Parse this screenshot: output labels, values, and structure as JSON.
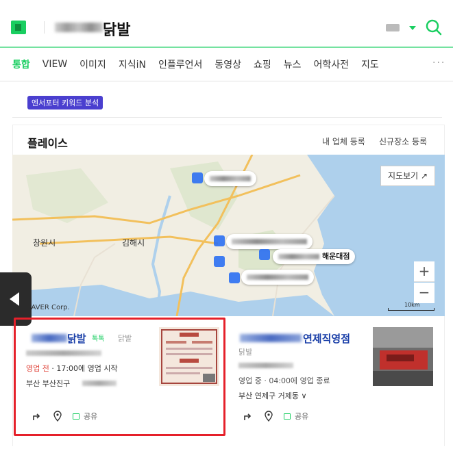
{
  "header": {
    "query_suffix": "닭발",
    "search_icon": "search-icon",
    "accent_color": "#19ce60"
  },
  "tabs": [
    {
      "label": "통합"
    },
    {
      "label": "VIEW"
    },
    {
      "label": "이미지"
    },
    {
      "label": "지식iN"
    },
    {
      "label": "인플루언서"
    },
    {
      "label": "동영상"
    },
    {
      "label": "쇼핑"
    },
    {
      "label": "뉴스"
    },
    {
      "label": "어학사전"
    },
    {
      "label": "지도"
    }
  ],
  "tabs_more": "···",
  "keyword_chip": "엔서포터 키워드 분석",
  "place": {
    "title": "플레이스",
    "link_register": "내 업체 등록",
    "link_new_place": "신규장소 등록",
    "map_view_button": "지도보기 ↗",
    "zoom_in": "+",
    "zoom_out": "−",
    "scale": "10km",
    "map_labels": {
      "changwon": "창원시",
      "gimhae": "김해시",
      "haeundae": "해운대점",
      "naver_corp": "NAVER Corp."
    }
  },
  "results": [
    {
      "title_suffix": "닭발",
      "talk_badge": "톡톡",
      "category": "닭발",
      "status_prefix": "영업 전",
      "status_text": " · 17:00에 영업 시작",
      "address": "부산 부산진구",
      "share_label": "공유",
      "highlighted": true
    },
    {
      "title_suffix": "연제직영점",
      "category": "닭발",
      "status_text": "영업 중 · 04:00에 영업 종료",
      "address": "부산 연제구 거제동 ∨",
      "share_label": "공유",
      "highlighted": false
    }
  ],
  "highlight_color": "#e5202a"
}
